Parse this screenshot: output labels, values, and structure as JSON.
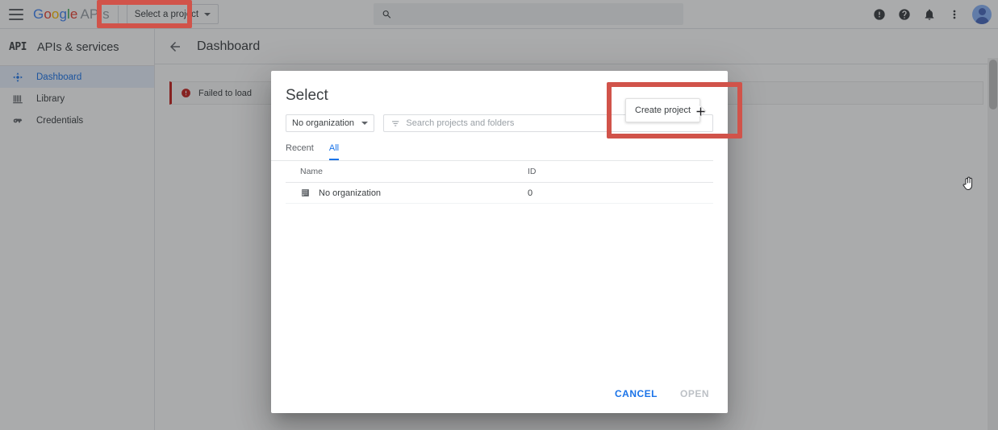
{
  "appbar": {
    "menu_icon": "hamburger-menu-icon",
    "brand": {
      "g1": "G",
      "g2": "o",
      "g3": "o",
      "g4": "g",
      "g5": "l",
      "g6": "e",
      "apis": "APIs"
    },
    "project_button": {
      "label": "Select a project",
      "caret_icon": "chevron-down-icon"
    },
    "search": {
      "placeholder": "",
      "value": "",
      "icon": "search-icon"
    },
    "icons": [
      {
        "name": "alert-icon",
        "glyph": "!"
      },
      {
        "name": "help-icon",
        "glyph": "?"
      },
      {
        "name": "notifications-bell-icon",
        "glyph": "bell"
      },
      {
        "name": "more-vert-icon",
        "glyph": "⋮"
      }
    ],
    "avatar": "user-avatar"
  },
  "sidebar": {
    "logo": "API",
    "title": "APIs & services",
    "items": [
      {
        "label": "Dashboard",
        "icon": "dashboard-icon",
        "active": true
      },
      {
        "label": "Library",
        "icon": "library-icon",
        "active": false
      },
      {
        "label": "Credentials",
        "icon": "credentials-key-icon",
        "active": false
      }
    ]
  },
  "content": {
    "back_icon": "back-arrow-icon",
    "title": "Dashboard",
    "banner": {
      "icon": "error-icon",
      "text": "Failed to load"
    }
  },
  "dialog": {
    "title": "Select",
    "org_select": {
      "label": "No organization",
      "caret_icon": "chevron-down-icon"
    },
    "search": {
      "placeholder": "Search projects and folders",
      "value": "",
      "icon": "filter-icon"
    },
    "tabs": [
      {
        "label": "Recent",
        "active": false
      },
      {
        "label": "All",
        "active": true
      }
    ],
    "table": {
      "columns": [
        "Name",
        "ID"
      ],
      "rows": [
        {
          "icon": "organization-building-icon",
          "name": "No organization",
          "id": "0"
        }
      ]
    },
    "create_project": {
      "tooltip": "Create project",
      "icon": "plus-icon"
    },
    "actions": [
      {
        "label": "CANCEL",
        "state": "enabled"
      },
      {
        "label": "OPEN",
        "state": "disabled"
      }
    ]
  },
  "annotations": {
    "color": "#d1534a",
    "boxes": [
      "select-a-project-button",
      "create-project-button"
    ]
  }
}
